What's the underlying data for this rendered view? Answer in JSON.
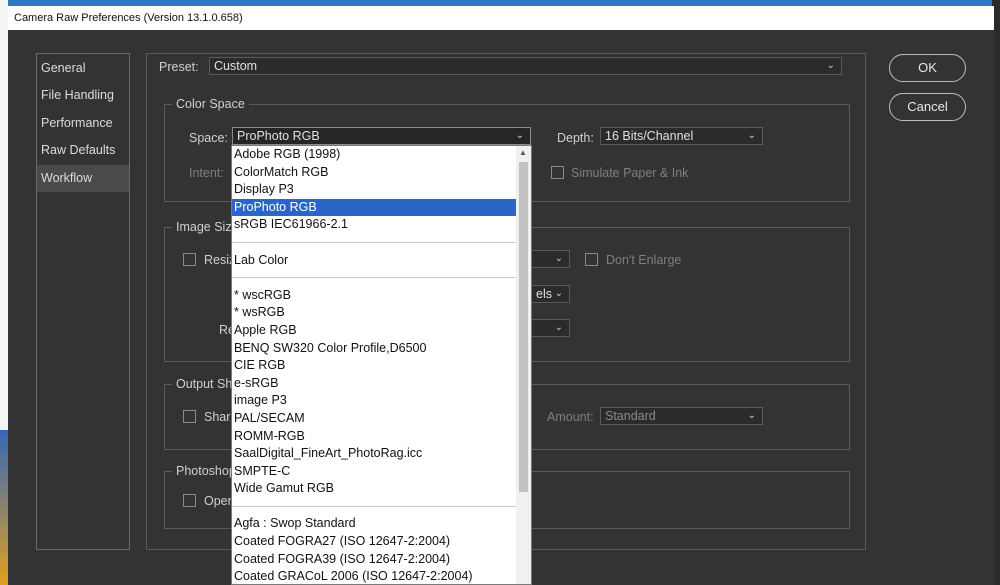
{
  "window": {
    "title": "Camera Raw Preferences  (Version 13.1.0.658)"
  },
  "sidebar": {
    "items": [
      {
        "label": "General"
      },
      {
        "label": "File Handling"
      },
      {
        "label": "Performance"
      },
      {
        "label": "Raw Defaults"
      },
      {
        "label": "Workflow"
      }
    ]
  },
  "preset": {
    "label": "Preset:",
    "value": "Custom"
  },
  "color_space": {
    "title": "Color Space",
    "space_label": "Space:",
    "space_value": "ProPhoto RGB",
    "depth_label": "Depth:",
    "depth_value": "16 Bits/Channel",
    "intent_label": "Intent:",
    "simulate_label": "Simulate Paper & Ink"
  },
  "image_sizing": {
    "title_partial": "Image Sizi",
    "resize_partial": "Resiz",
    "dont_enlarge": "Don't Enlarge",
    "units_partial": "els",
    "res_partial": "Re"
  },
  "output_sharpening": {
    "title_partial": "Output Sh",
    "sharpen_partial": "Sharp",
    "amount_label": "Amount:",
    "amount_value": "Standard"
  },
  "photoshop": {
    "title_partial": "Photoshop",
    "open_partial": "Open"
  },
  "buttons": {
    "ok": "OK",
    "cancel": "Cancel"
  },
  "space_dropdown": {
    "selected": "ProPhoto RGB",
    "items": [
      "Adobe RGB (1998)",
      "ColorMatch RGB",
      "Display P3",
      "ProPhoto RGB",
      "sRGB IEC61966-2.1",
      "---",
      "Lab Color",
      "---",
      "* wscRGB",
      "* wsRGB",
      "Apple RGB",
      "BENQ SW320 Color Profile,D6500",
      "CIE RGB",
      "e-sRGB",
      "image P3",
      "PAL/SECAM",
      "ROMM-RGB",
      "SaalDigital_FineArt_PhotoRag.icc",
      "SMPTE-C",
      "Wide Gamut RGB",
      "---",
      "Agfa : Swop Standard",
      "Coated FOGRA27 (ISO 12647-2:2004)",
      "Coated FOGRA39 (ISO 12647-2:2004)",
      "Coated GRACoL 2006 (ISO 12647-2:2004)"
    ]
  },
  "colors": {
    "selection": "#2a66c8",
    "dialog_bg": "#333333"
  }
}
